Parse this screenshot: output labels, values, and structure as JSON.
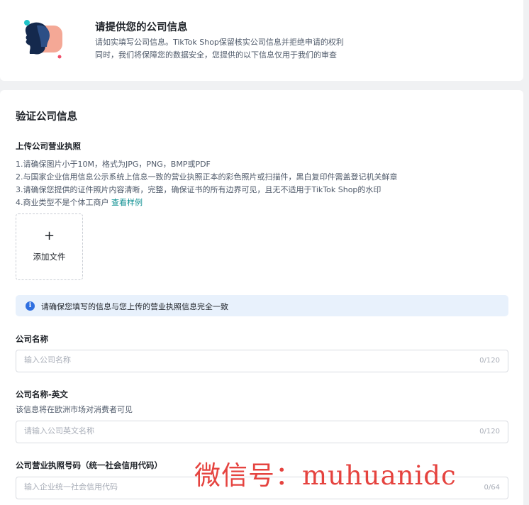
{
  "intro": {
    "title": "请提供您的公司信息",
    "line1": "请如实填写公司信息。TikTok Shop保留核实公司信息并拒绝申请的权利",
    "line2": "同时，我们将保障您的数据安全，您提供的以下信息仅用于我们的审查"
  },
  "section": {
    "title": "验证公司信息",
    "license": {
      "label": "上传公司营业执照",
      "req1": "1.请确保图片小于10M，格式为JPG，PNG，BMP或PDF",
      "req2": "2.与国家企业信用信息公示系统上信息一致的营业执照正本的彩色照片或扫描件，黑白复印件需盖登记机关鲜章",
      "req3": "3.请确保您提供的证件照片内容清晰，完整，确保证书的所有边界可见，且无不适用于TikTok Shop的水印",
      "req4": "4.商业类型不是个体工商户",
      "sample_link": "查看样例",
      "upload_plus": "+",
      "upload_label": "添加文件"
    },
    "alert": "请确保您填写的信息与您上传的营业执照信息完全一致",
    "company_name": {
      "label": "公司名称",
      "placeholder": "输入公司名称",
      "count": "0/120"
    },
    "company_name_en": {
      "label": "公司名称-英文",
      "hint": "该信息将在欧洲市场对消费者可见",
      "placeholder": "请输入公司英文名称",
      "count": "0/120"
    },
    "license_no": {
      "label": "公司营业执照号码（统一社会信用代码）",
      "placeholder": "输入企业统一社会信用代码",
      "count": "0/64"
    }
  },
  "watermark": "微信号：muhuanidc",
  "colors": {
    "accent": "#0d8f91",
    "info": "#2f6fe0",
    "alert_bg": "#e8f1fc",
    "watermark": "#e3342f"
  }
}
